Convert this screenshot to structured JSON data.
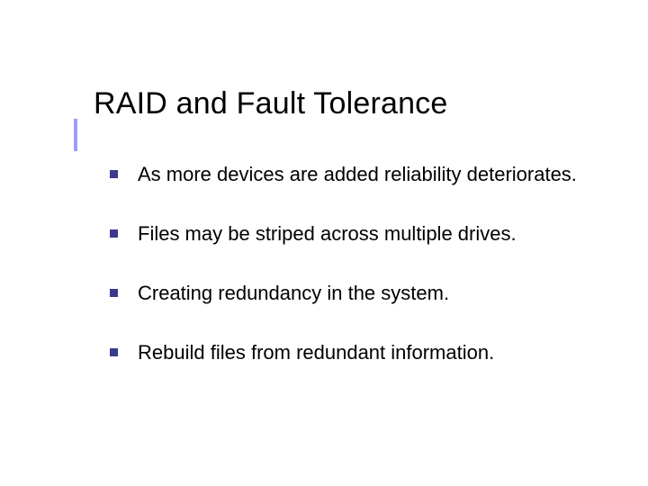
{
  "slide": {
    "title": "RAID and Fault Tolerance",
    "bullets": [
      "As more devices are added reliability deteriorates.",
      "Files may be striped across multiple drives.",
      "Creating redundancy in the system.",
      "Rebuild files from redundant information."
    ]
  },
  "colors": {
    "accent_bar": "#9c9cff",
    "bullet_square": "#3a3a8f"
  }
}
